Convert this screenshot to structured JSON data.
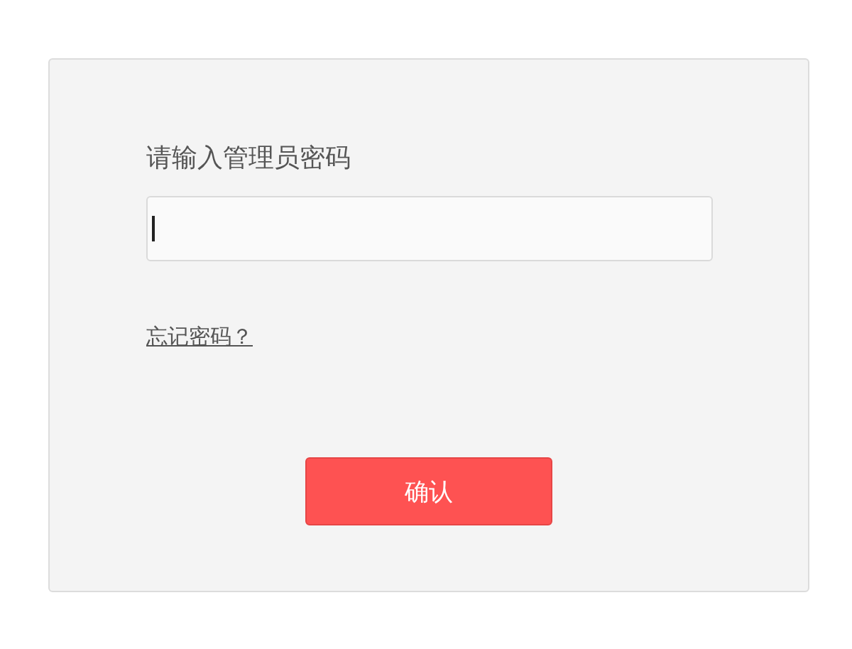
{
  "login": {
    "label": "请输入管理员密码",
    "password_field": {
      "focused": true
    },
    "forgot_link": "忘记密码？",
    "confirm_button": "确认"
  }
}
